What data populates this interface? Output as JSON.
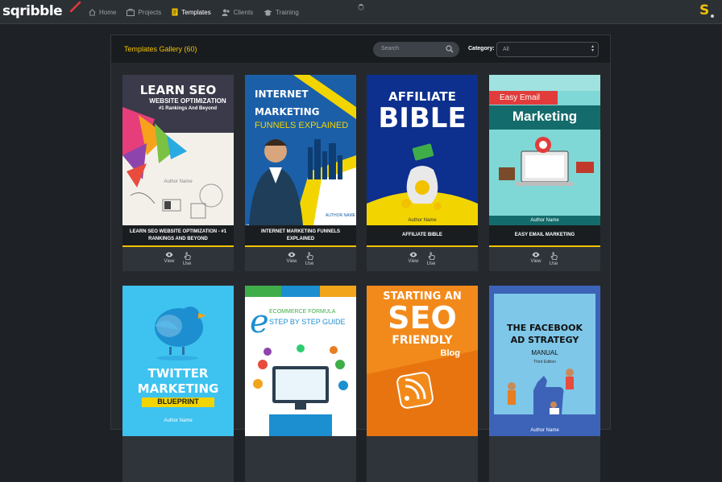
{
  "app": {
    "logo": "sqribble",
    "user_initial": "S"
  },
  "nav": [
    {
      "label": "Home",
      "icon": "home-icon"
    },
    {
      "label": "Projects",
      "icon": "projects-icon"
    },
    {
      "label": "Templates",
      "icon": "templates-icon"
    },
    {
      "label": "Clients",
      "icon": "clients-icon"
    },
    {
      "label": "Training",
      "icon": "training-icon"
    }
  ],
  "gallery": {
    "title": "Templates Gallery (60)",
    "search_placeholder": "Search",
    "category_label": "Category:",
    "category_value": "All",
    "view_label": "View",
    "use_label": "Use"
  },
  "templates": [
    {
      "title": "LEARN SEO WEBSITE OPTIMIZATION - #1 RANKINGS AND BEYOND",
      "cover_l1": "LEARN SEO",
      "cover_l2": "WEBSITE OPTIMIZATION",
      "cover_l3": "#1 Rankings And Beyond",
      "author": "Author Name"
    },
    {
      "title": "INTERNET MARKETING FUNNELS EXPLAINED",
      "cover_l1": "INTERNET",
      "cover_l2": "MARKETING",
      "cover_l3": "FUNNELS EXPLAINED",
      "author": "AUTHOR NAME"
    },
    {
      "title": "AFFILIATE BIBLE",
      "cover_l1": "AFFILIATE",
      "cover_l2": "BIBLE",
      "author": "Author Name"
    },
    {
      "title": "EASY EMAIL MARKETING",
      "cover_l1": "Easy Email",
      "cover_l2": "Marketing",
      "author": "Author Name"
    },
    {
      "cover_l1": "TWITTER",
      "cover_l2": "MARKETING",
      "cover_l3": "BLUEPRINT",
      "author": "Author Name"
    },
    {
      "cover_l1": "ECOMMERCE FORMULA",
      "cover_l2": "STEP BY STEP GUIDE"
    },
    {
      "cover_l1": "STARTING AN",
      "cover_l2": "SEO",
      "cover_l3": "FRIENDLY",
      "cover_l4": "Blog"
    },
    {
      "cover_l1": "THE FACEBOOK",
      "cover_l2": "AD STRATEGY",
      "cover_l3": "MANUAL",
      "cover_l4": "Third Edition",
      "author": "Author Name"
    }
  ],
  "colors": {
    "accent": "#f2c200",
    "bg": "#1e2226",
    "panel": "#25292d"
  }
}
